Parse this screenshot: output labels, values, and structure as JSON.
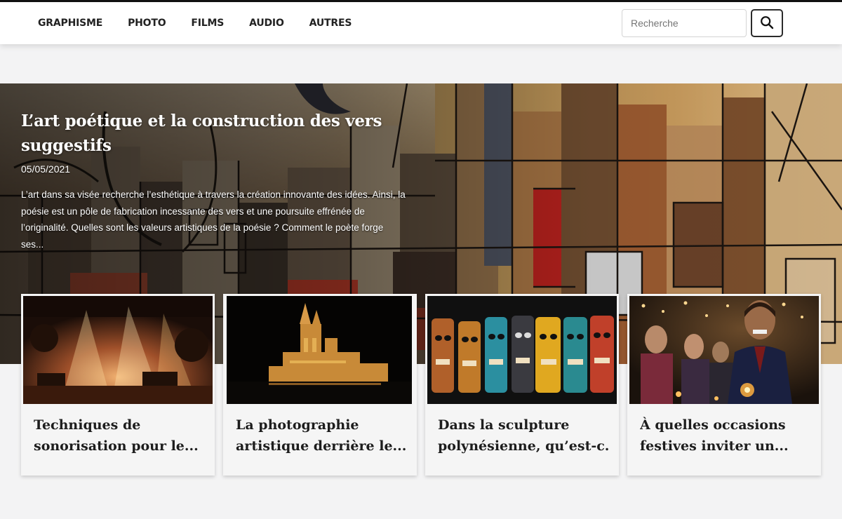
{
  "nav": {
    "items": [
      "GRAPHISME",
      "PHOTO",
      "FILMS",
      "AUDIO",
      "AUTRES"
    ],
    "search_placeholder": "Recherche",
    "search_icon": "search-icon"
  },
  "hero": {
    "title": "L’art poétique et la construction des vers suggestifs",
    "date": "05/05/2021",
    "excerpt": "L’art dans sa visée recherche l’esthétique à travers la création innovante des idées. Ainsi, la poésie est un pôle de fabrication incessante des vers et une poursuite effrénée de l’originalité. Quelles sont les valeurs artistiques de la poésie ? Comment le poète forge ses...",
    "image": "abstract-cubist-painting"
  },
  "cards": [
    {
      "title_lines": [
        "Techniques de",
        "sonorisation pour le..."
      ],
      "image": "stage-concert-lights"
    },
    {
      "title_lines": [
        "La photographie",
        "artistique derrière le..."
      ],
      "image": "cathedral-night-lights"
    },
    {
      "title_lines": [
        "Dans la sculpture",
        "polynésienne, qu’est-c..."
      ],
      "image": "tiki-masks"
    },
    {
      "title_lines": [
        "À quelles occasions",
        "festives inviter un..."
      ],
      "image": "party-man-candles"
    }
  ]
}
